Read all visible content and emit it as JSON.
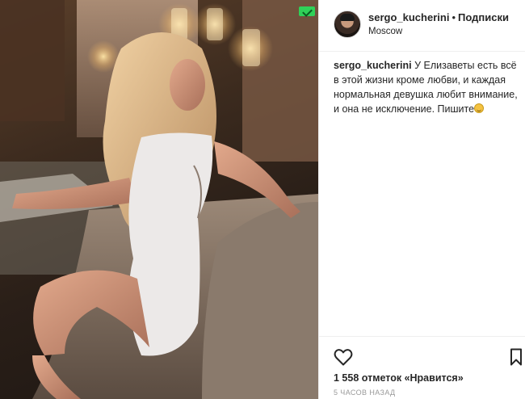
{
  "post": {
    "username": "sergo_kucherini",
    "separator": "•",
    "follow_label": "Подписки",
    "location": "Moscow",
    "caption_username": "sergo_kucherini",
    "caption_text": "У Елизаветы есть всё в этой жизни кроме любви, и каждая нормальная девушка любит внимание, и она не исключение. Пишите",
    "caption_emoji": "smiley-icon",
    "likes_count": "1 558",
    "likes_word": "отметок «Нравится»",
    "timestamp": "5 ЧАСОВ НАЗАД"
  },
  "icons": {
    "like": "heart-icon",
    "save": "bookmark-icon",
    "badge": "check-badge-icon"
  },
  "colors": {
    "text": "#262626",
    "muted": "#999999",
    "divider": "#efefef",
    "badge": "#2fd158"
  }
}
